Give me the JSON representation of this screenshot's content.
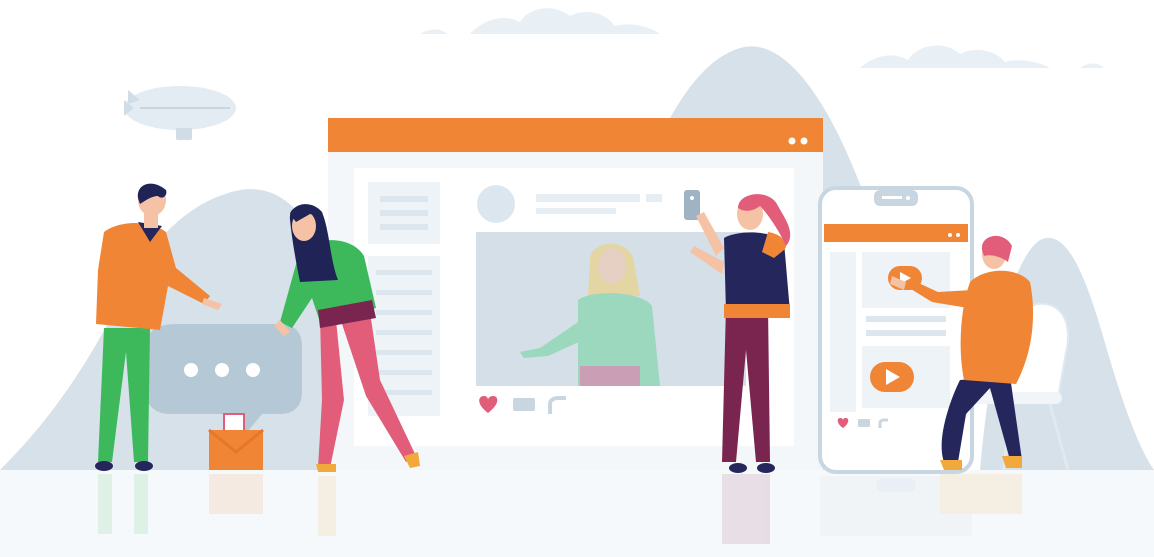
{
  "scene": {
    "description_tag": "",
    "colors": {
      "accent_orange": "#F08536",
      "hill_blue": "#D6E1EA",
      "cloud": "#E9F0F5",
      "panel": "#EEF3F7",
      "panel_line": "#DCE6EE",
      "photo_bg": "#D4DFE8",
      "skin": "#F5C2A5",
      "hair_dark": "#1F2356",
      "green": "#3DB95C",
      "pink": "#E25D7A",
      "navy": "#24265C",
      "maroon": "#7A2550",
      "heart": "#E25D7A",
      "bubble": "#B5C8D6",
      "white": "#FFFFFF"
    },
    "icons": [
      "blimp-icon",
      "chat-bubble-icon",
      "envelope-icon",
      "heart-icon",
      "comment-icon",
      "share-icon",
      "play-icon",
      "smartphone-icon"
    ]
  }
}
